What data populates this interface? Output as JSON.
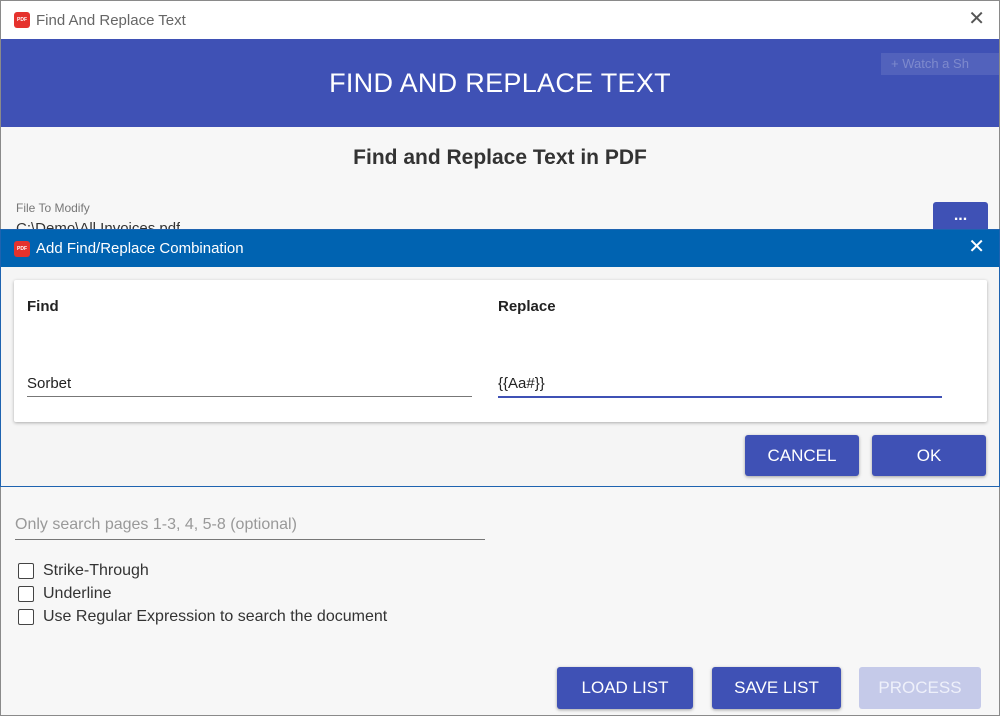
{
  "window": {
    "title": "Find And Replace Text",
    "close_glyph": "✕",
    "app_icon_text": "PDF"
  },
  "banner": {
    "title": "FIND AND REPLACE TEXT",
    "ghost_text": "+ Watch a Sh"
  },
  "main": {
    "subtitle": "Find and Replace Text in PDF",
    "file_label": "File To Modify",
    "file_value": "C:\\Demo\\All Invoices.pdf",
    "browse_label": "...",
    "pages_placeholder": "Only search pages 1-3, 4, 5-8 (optional)",
    "options": [
      {
        "label": "Strike-Through",
        "checked": false
      },
      {
        "label": "Underline",
        "checked": false
      },
      {
        "label": "Use Regular Expression to search the document",
        "checked": false
      }
    ],
    "buttons": {
      "load_list": "LOAD LIST",
      "save_list": "SAVE LIST",
      "process": "PROCESS"
    }
  },
  "dialog": {
    "title": "Add Find/Replace Combination",
    "close_glyph": "✕",
    "find_label": "Find",
    "replace_label": "Replace",
    "find_value": "Sorbet",
    "replace_value": "{{Aa#}}",
    "cancel_label": "CANCEL",
    "ok_label": "OK"
  },
  "colors": {
    "primary": "#3f51b5",
    "dialog_titlebar": "#0063b1",
    "disabled": "#c5cae9"
  }
}
